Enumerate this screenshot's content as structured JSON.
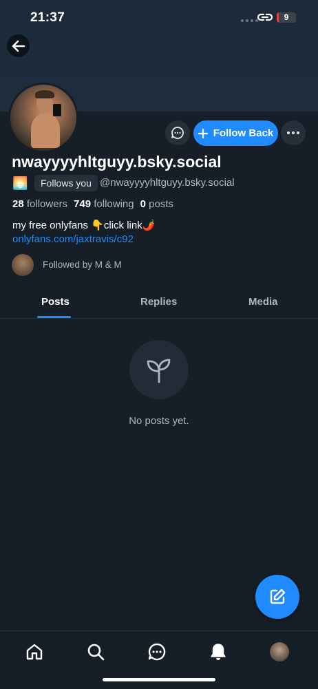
{
  "status_bar": {
    "time": "21:37",
    "battery_level": "9",
    "battery_fraction": 0.09
  },
  "header": {
    "back_icon": "arrow-left-icon"
  },
  "actions": {
    "follow_label": "Follow Back",
    "message_icon": "chat-bubble-icon",
    "more_icon": "ellipsis-icon"
  },
  "profile": {
    "display_name": "nwayyyyhltguyy.bsky.social",
    "emoji": "🌅",
    "follows_you": "Follows you",
    "handle": "@nwayyyyhltguyy.bsky.social",
    "followers_count": "28",
    "followers_label": "followers",
    "following_count": "749",
    "following_label": "following",
    "posts_count": "0",
    "posts_label": "posts",
    "bio": "my free onlyfans 👇click link🌶️",
    "bio_link": "onlyfans.com/jaxtravis/c92",
    "followed_by": "Followed by M & M"
  },
  "tabs": [
    {
      "label": "Posts",
      "active": true
    },
    {
      "label": "Replies",
      "active": false
    },
    {
      "label": "Media",
      "active": false
    }
  ],
  "empty_state": {
    "text": "No posts yet.",
    "icon": "sprout-icon"
  },
  "fab": {
    "icon": "compose-icon"
  },
  "bottom_nav": [
    {
      "name": "home",
      "icon": "home-icon"
    },
    {
      "name": "search",
      "icon": "search-icon"
    },
    {
      "name": "chat",
      "icon": "chat-icon"
    },
    {
      "name": "notifications",
      "icon": "bell-icon"
    },
    {
      "name": "profile",
      "icon": "avatar"
    }
  ],
  "colors": {
    "background": "#161e27",
    "accent": "#208bfe",
    "battery_low": "#e0413c"
  }
}
